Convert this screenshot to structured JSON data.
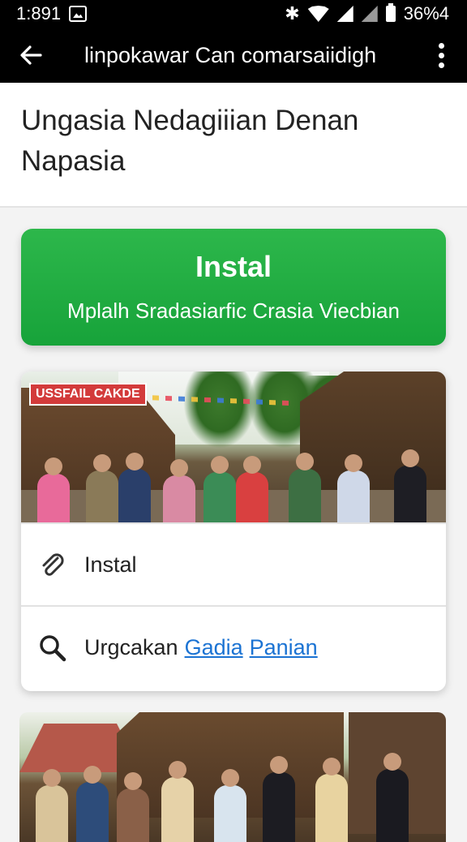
{
  "status_bar": {
    "time": "1:891",
    "battery": "36%4"
  },
  "toolbar": {
    "title": "linpokawar Can comarsaiidigh"
  },
  "header": {
    "title": "Ungasia Nedagiiian Denan Napasia"
  },
  "install_card": {
    "title": "Instal",
    "subtitle": "Mplalh Sradasiarfic Crasia Viecbian"
  },
  "content_card": {
    "photo_label": "USSFAIL CAKDE",
    "rows": [
      {
        "label": "Instal",
        "icon": "paperclip-icon"
      },
      {
        "label": "Urgcakan",
        "icon": "search-icon",
        "links": [
          "Gadia",
          "Panian"
        ]
      }
    ]
  },
  "colors": {
    "accent_green": "#1fae41",
    "link_blue": "#1b73d3",
    "toolbar_bg": "#000000"
  }
}
